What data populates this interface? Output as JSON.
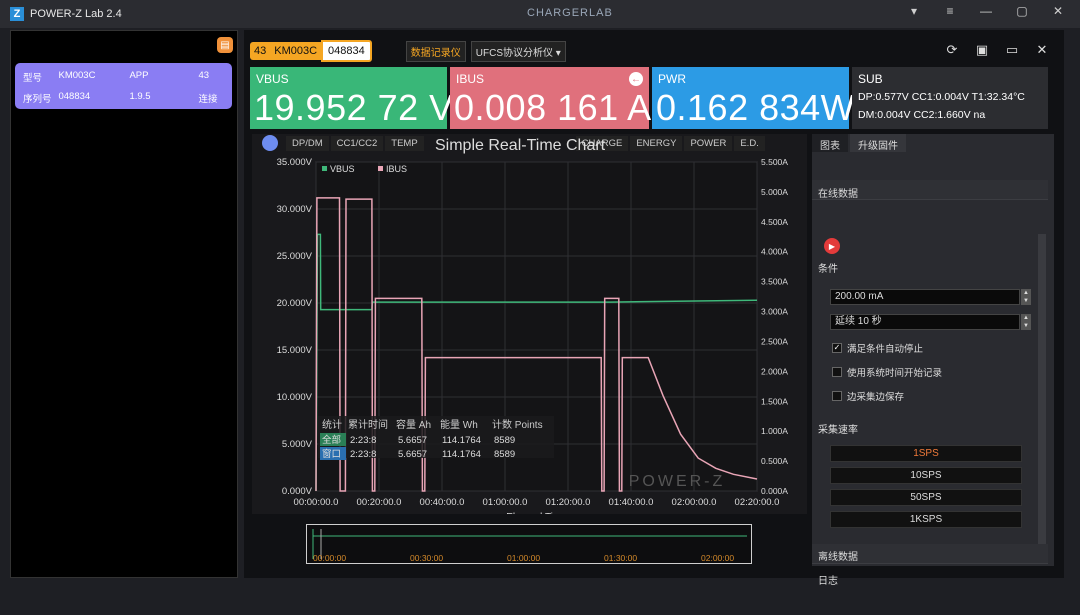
{
  "app": {
    "title": "POWER-Z Lab 2.4",
    "brand": "CHARGERLAB"
  },
  "left_panel": {
    "device": {
      "row1": [
        "型号",
        "KM003C",
        "APP",
        "43"
      ],
      "row2": [
        "序列号",
        "048834",
        "1.9.5",
        "连接"
      ]
    }
  },
  "toolbar": {
    "num": "43",
    "model": "KM003C",
    "serial": "048834",
    "logger_label": "数据记录仪",
    "ufcs_label": "UFCS协议分析仪"
  },
  "meters": {
    "vbus": {
      "label": "VBUS",
      "value": "19.952 72 V"
    },
    "ibus": {
      "label": "IBUS",
      "value": "0.008 161 A"
    },
    "pwr": {
      "label": "PWR",
      "value": "0.162 834W"
    },
    "sub": {
      "label": "SUB",
      "line1": "DP:0.577V  CC1:0.004V  T1:32.34°C",
      "line2": "DM:0.004V  CC2:1.660V  na"
    }
  },
  "chart_tabs": [
    "DP/DM",
    "CC1/CC2",
    "TEMP",
    "CHARGE",
    "ENERGY",
    "POWER",
    "E.D."
  ],
  "chart_data": {
    "type": "line",
    "title": "Simple Real-Time Chart",
    "xlabel": "Elapsed Time",
    "x_ticks": [
      "00:00:00.0",
      "00:20:00.0",
      "00:40:00.0",
      "01:00:00.0",
      "01:20:00.0",
      "01:40:00.0",
      "02:00:00.0",
      "02:20:00.0"
    ],
    "y_left_ticks": [
      "0.000V",
      "5.000V",
      "10.000V",
      "15.000V",
      "20.000V",
      "25.000V",
      "30.000V",
      "35.000V"
    ],
    "y_right_ticks": [
      "0.000A",
      "0.500A",
      "1.000A",
      "1.500A",
      "2.000A",
      "2.500A",
      "3.000A",
      "3.500A",
      "4.000A",
      "4.500A",
      "5.000A",
      "5.500A"
    ],
    "ylim_left": [
      0,
      35
    ],
    "ylim_right": [
      0,
      5.5
    ],
    "xlim_min": [
      0,
      150
    ],
    "series": [
      {
        "name": "VBUS",
        "axis": "left",
        "color": "#3fb87a",
        "points": [
          [
            0,
            0
          ],
          [
            0.5,
            27.3
          ],
          [
            1.5,
            27.3
          ],
          [
            1.6,
            19.3
          ],
          [
            19,
            19.3
          ],
          [
            19.2,
            20.1
          ],
          [
            100,
            20.1
          ],
          [
            150,
            20.3
          ]
        ]
      },
      {
        "name": "IBUS",
        "axis": "right",
        "color": "#e9a5b6",
        "points": [
          [
            0,
            0
          ],
          [
            0.3,
            4.9
          ],
          [
            8,
            4.9
          ],
          [
            8.2,
            0
          ],
          [
            10,
            0
          ],
          [
            10.2,
            4.88
          ],
          [
            19,
            4.88
          ],
          [
            19.2,
            0
          ],
          [
            20,
            0
          ],
          [
            20.2,
            3.22
          ],
          [
            36,
            3.22
          ],
          [
            36.2,
            0
          ],
          [
            37,
            0
          ],
          [
            37.2,
            2.23
          ],
          [
            97,
            2.23
          ],
          [
            97.2,
            0
          ],
          [
            98,
            0
          ],
          [
            98.2,
            3.22
          ],
          [
            103,
            3.22
          ],
          [
            103.2,
            0
          ],
          [
            104,
            0
          ],
          [
            104.2,
            2.23
          ],
          [
            113,
            2.23
          ],
          [
            118,
            1.6
          ],
          [
            124,
            0.95
          ],
          [
            130,
            0.55
          ],
          [
            136,
            0.38
          ],
          [
            142,
            0.28
          ],
          [
            150,
            0.2
          ]
        ]
      }
    ],
    "stats": {
      "headers": [
        "统计",
        "累计时间",
        "容量 Ah",
        "能量 Wh",
        "计数 Points"
      ],
      "rows": [
        [
          "全部",
          "2:23:8",
          "5.6657",
          "114.1764",
          "8589"
        ],
        [
          "窗口",
          "2:23:8",
          "5.6657",
          "114.1764",
          "8589"
        ]
      ]
    },
    "watermark": "POWER-Z"
  },
  "timeline": {
    "ticks": [
      "00:00:00",
      "00:30:00",
      "01:00:00",
      "01:30:00",
      "02:00:00"
    ]
  },
  "right_panel": {
    "tabs": [
      "图表",
      "升级固件"
    ],
    "online_data": "在线数据",
    "condition": "条件",
    "current_value": "200.00 mA",
    "duration_value": "延续 10 秒",
    "checkboxes": [
      {
        "label": "满足条件自动停止",
        "checked": true
      },
      {
        "label": "使用系统时间开始记录",
        "checked": false
      },
      {
        "label": "边采集边保存",
        "checked": false
      }
    ],
    "rate_title": "采集速率",
    "rates": [
      "1SPS",
      "10SPS",
      "50SPS",
      "1KSPS"
    ],
    "offline_data": "离线数据",
    "log": "日志"
  },
  "colors": {
    "vbus": "#39b778",
    "ibus": "#e0707c",
    "pwr": "#2c9be5",
    "accent": "#f5a623"
  }
}
